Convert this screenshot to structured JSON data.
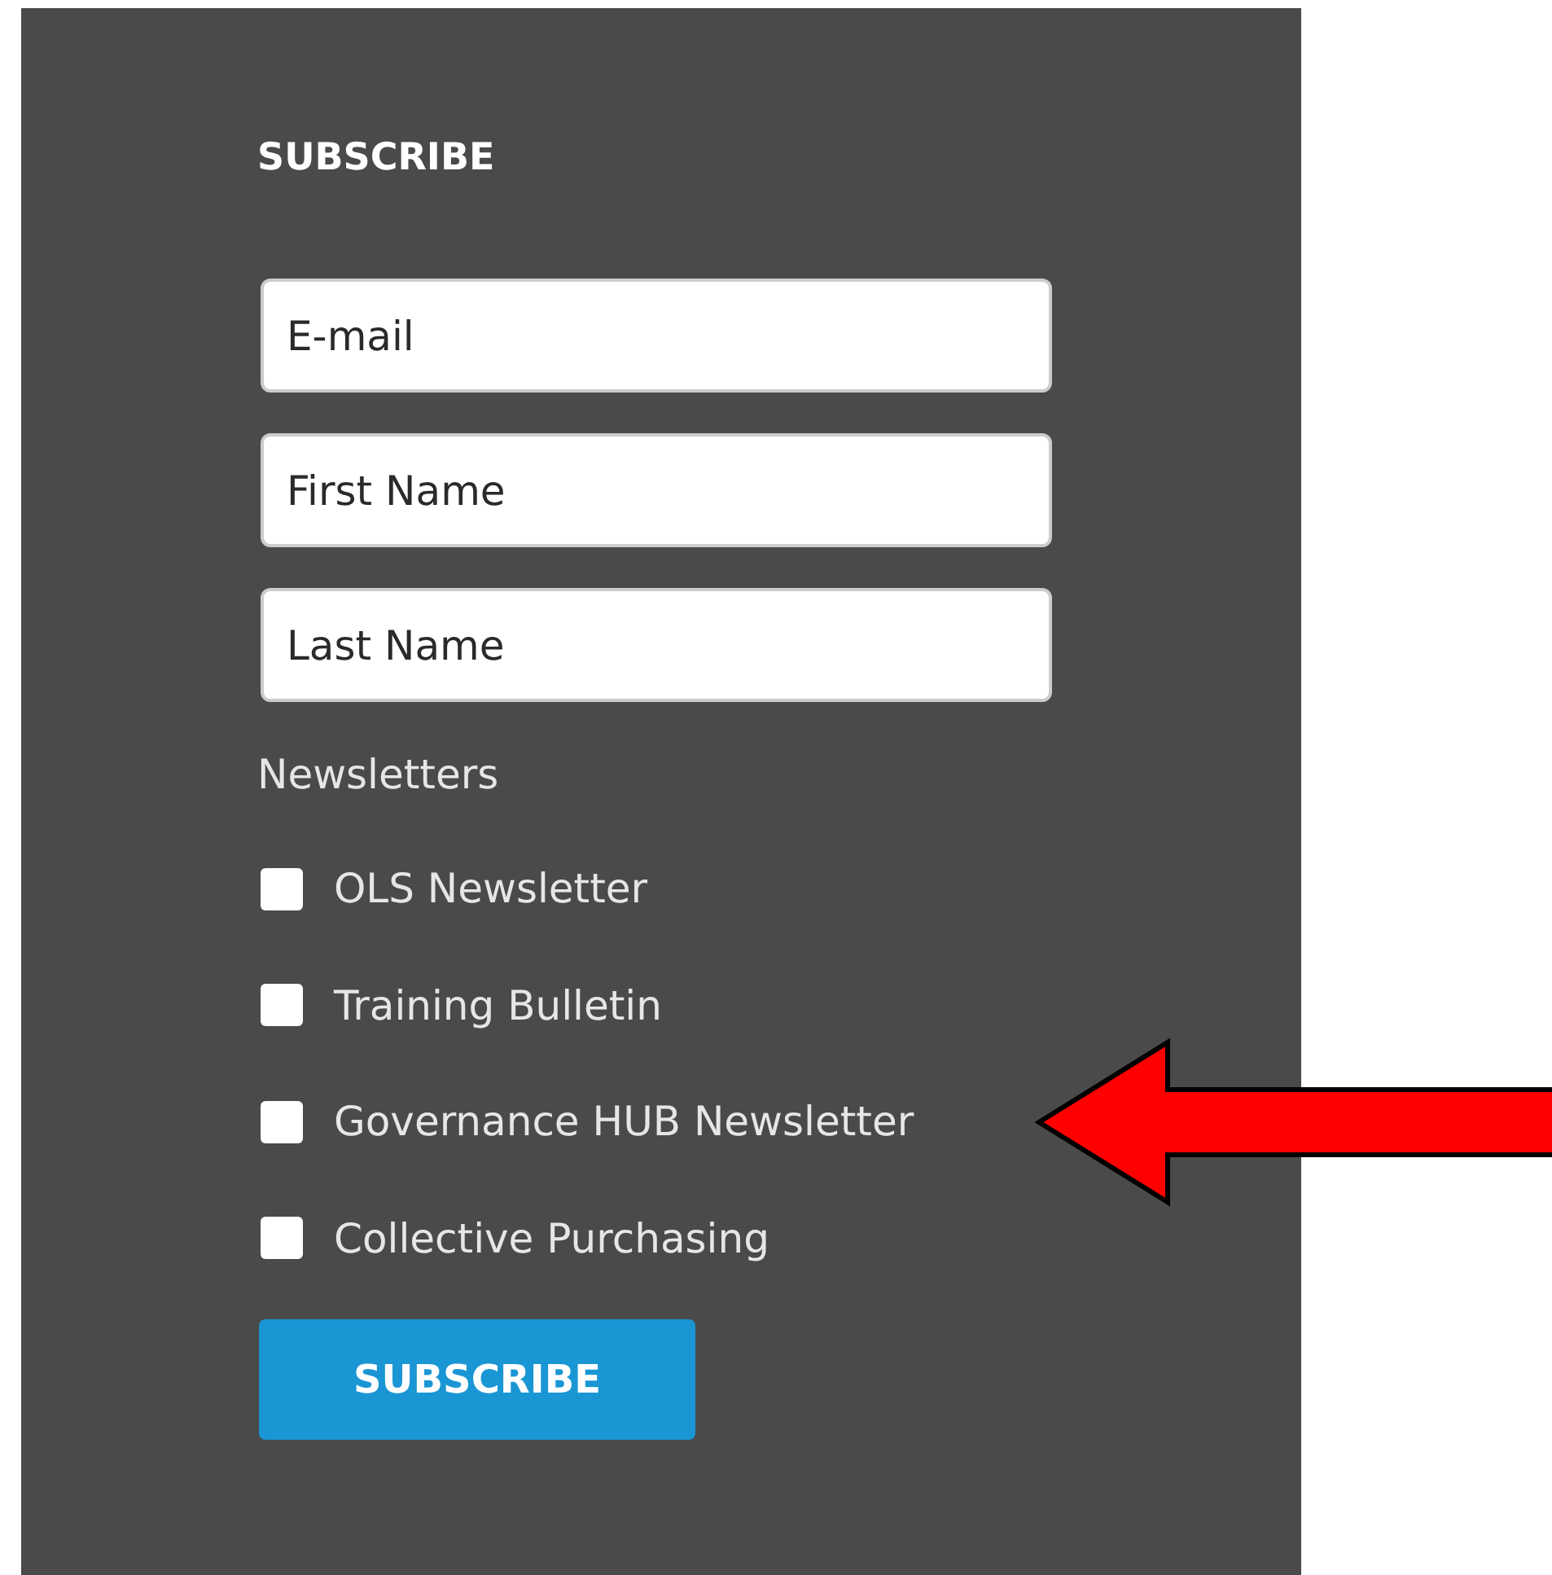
{
  "form": {
    "title": "SUBSCRIBE",
    "fields": [
      {
        "placeholder": "E-mail"
      },
      {
        "placeholder": "First Name"
      },
      {
        "placeholder": "Last Name"
      }
    ],
    "newsletters_label": "Newsletters",
    "newsletters": [
      {
        "label": "OLS Newsletter",
        "checked": false,
        "highlighted": false
      },
      {
        "label": "Training Bulletin",
        "checked": false,
        "highlighted": false
      },
      {
        "label": "Governance HUB Newsletter",
        "checked": false,
        "highlighted": true
      },
      {
        "label": "Collective Purchasing",
        "checked": false,
        "highlighted": false
      }
    ],
    "button": "SUBSCRIBE"
  }
}
